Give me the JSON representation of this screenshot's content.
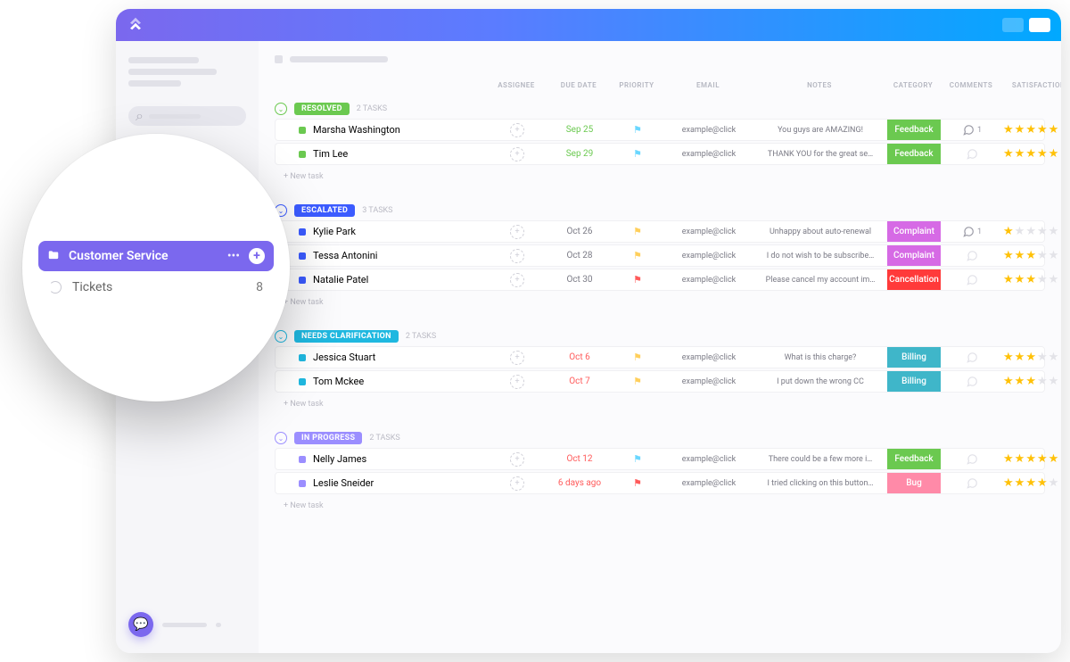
{
  "lens": {
    "space_label": "Customer Service",
    "list_label": "Tickets",
    "list_count": "8"
  },
  "columns": {
    "assignee": "ASSIGNEE",
    "due_date": "DUE DATE",
    "priority": "PRIORITY",
    "email": "EMAIL",
    "notes": "NOTES",
    "category": "CATEGORY",
    "comments": "COMMENTS",
    "satisfaction": "SATISFACTION LEVEL"
  },
  "new_task_label": "+ New task",
  "groups": [
    {
      "name": "RESOLVED",
      "color": "#6bc950",
      "count_label": "2 TASKS",
      "tasks": [
        {
          "name": "Marsha Washington",
          "due": "Sep 25",
          "due_class": "due-green",
          "flag": "#6ad7ff",
          "email": "example@click",
          "notes": "You guys are AMAZING!",
          "category": "Feedback",
          "cat_color": "#6bc950",
          "comments": "1",
          "stars": 5
        },
        {
          "name": "Tim Lee",
          "due": "Sep 29",
          "due_class": "due-green",
          "flag": "#6ad7ff",
          "email": "example@click",
          "notes": "THANK YOU for the great se…",
          "category": "Feedback",
          "cat_color": "#6bc950",
          "comments": "",
          "stars": 5
        }
      ]
    },
    {
      "name": "ESCALATED",
      "color": "#3b5bff",
      "count_label": "3 TASKS",
      "tasks": [
        {
          "name": "Kylie Park",
          "due": "Oct 26",
          "due_class": "due-normal",
          "flag": "#ffcf5b",
          "email": "example@click",
          "notes": "Unhappy about auto-renewal",
          "category": "Complaint",
          "cat_color": "#d66ae5",
          "comments": "1",
          "stars": 1
        },
        {
          "name": "Tessa Antonini",
          "due": "Oct 28",
          "due_class": "due-normal",
          "flag": "#ffcf5b",
          "email": "example@click",
          "notes": "I do not wish to be subscribe…",
          "category": "Complaint",
          "cat_color": "#d66ae5",
          "comments": "",
          "stars": 3
        },
        {
          "name": "Natalie Patel",
          "due": "Oct 30",
          "due_class": "due-normal",
          "flag": "#ff5a5a",
          "email": "example@click",
          "notes": "Please cancel my account im…",
          "category": "Cancellation",
          "cat_color": "#ff3a3a",
          "comments": "",
          "stars": 3
        }
      ]
    },
    {
      "name": "NEEDS CLARIFICATION",
      "color": "#1fb8e0",
      "count_label": "2 TASKS",
      "tasks": [
        {
          "name": "Jessica Stuart",
          "due": "Oct 6",
          "due_class": "due-red",
          "flag": "#ffcf5b",
          "email": "example@click",
          "notes": "What is this charge?",
          "category": "Billing",
          "cat_color": "#3fb6c9",
          "comments": "",
          "stars": 3
        },
        {
          "name": "Tom Mckee",
          "due": "Oct 7",
          "due_class": "due-red",
          "flag": "#ffcf5b",
          "email": "example@click",
          "notes": "I put down the wrong CC",
          "category": "Billing",
          "cat_color": "#3fb6c9",
          "comments": "",
          "stars": 3
        }
      ]
    },
    {
      "name": "IN PROGRESS",
      "color": "#9b8eff",
      "count_label": "2 TASKS",
      "tasks": [
        {
          "name": "Nelly James",
          "due": "Oct 12",
          "due_class": "due-red",
          "flag": "#6ad7ff",
          "email": "example@click",
          "notes": "There could be a few more i…",
          "category": "Feedback",
          "cat_color": "#6bc950",
          "comments": "",
          "stars": 5
        },
        {
          "name": "Leslie Sneider",
          "due": "6 days ago",
          "due_class": "due-red",
          "flag": "#ff5a5a",
          "email": "example@click",
          "notes": "I tried clicking on this button…",
          "category": "Bug",
          "cat_color": "#ff8aa8",
          "comments": "",
          "stars": 4
        }
      ]
    }
  ]
}
